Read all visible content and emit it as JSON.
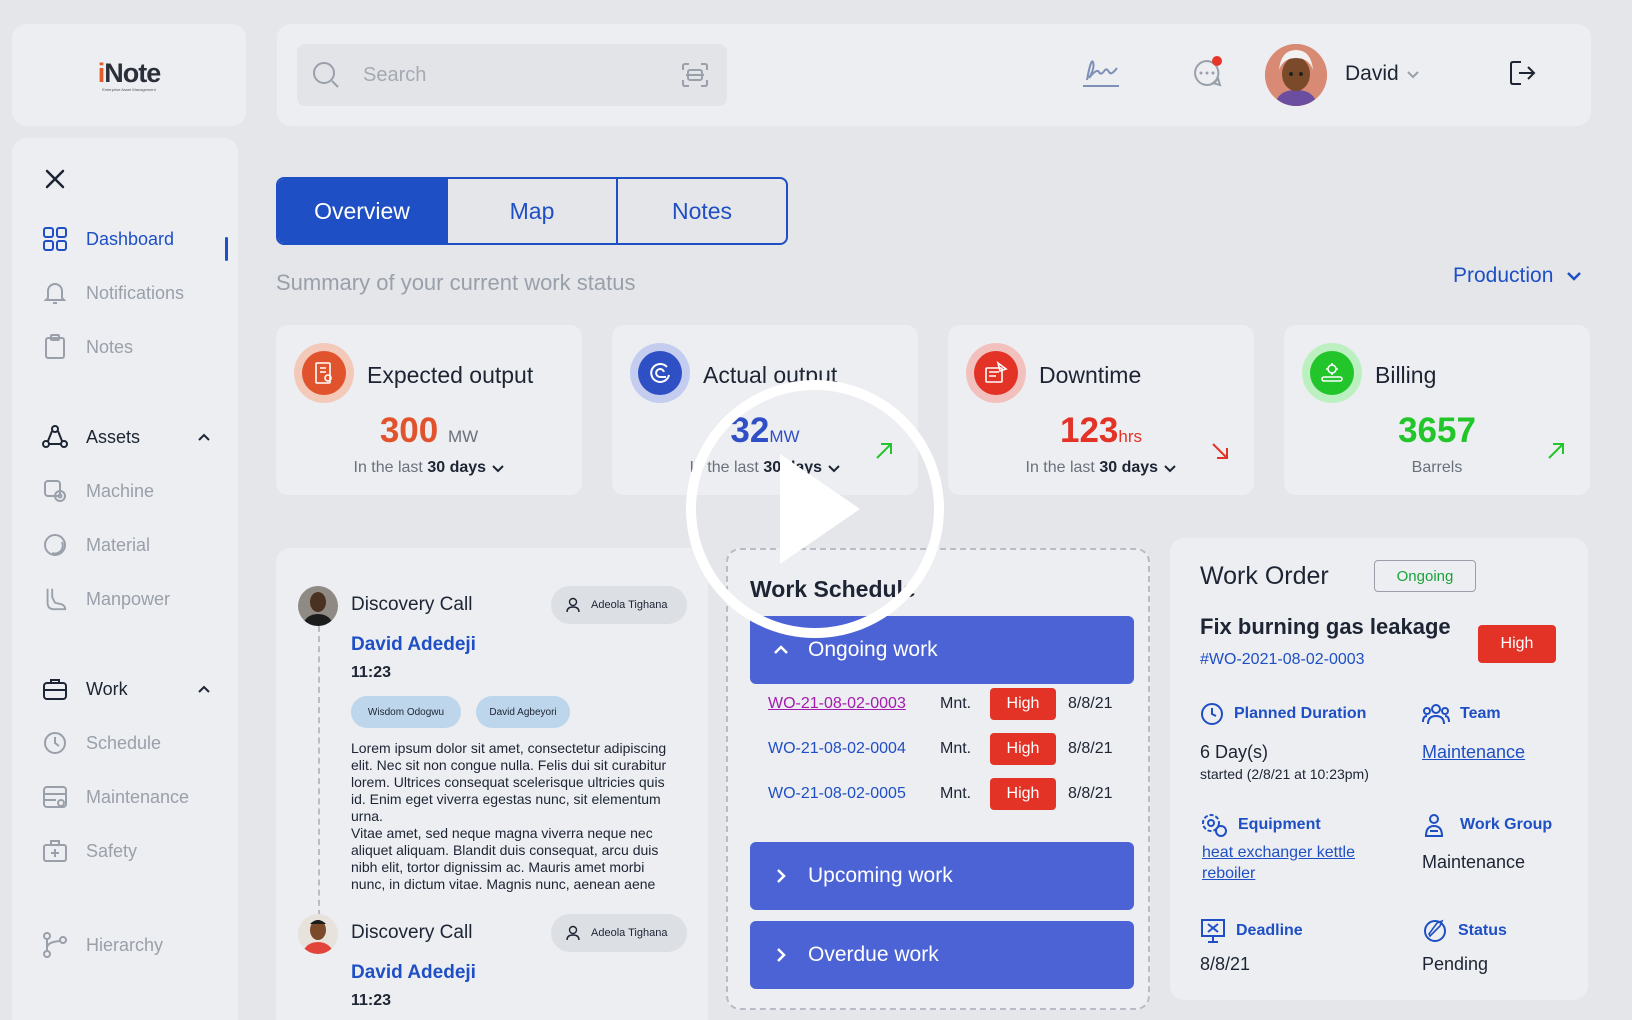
{
  "logo": {
    "text_i": "i",
    "text_rest": "Note",
    "subtitle": "Enterprise Asset Management"
  },
  "sidebar": {
    "items": [
      {
        "label": "Dashboard"
      },
      {
        "label": "Notifications"
      },
      {
        "label": "Notes"
      },
      {
        "label": "Assets"
      },
      {
        "label": "Machine"
      },
      {
        "label": "Material"
      },
      {
        "label": "Manpower"
      },
      {
        "label": "Work"
      },
      {
        "label": "Schedule"
      },
      {
        "label": "Maintenance"
      },
      {
        "label": "Safety"
      },
      {
        "label": "Hierarchy"
      }
    ]
  },
  "header": {
    "search_placeholder": "Search",
    "user_name": "David"
  },
  "tabs": [
    {
      "label": "Overview"
    },
    {
      "label": "Map"
    },
    {
      "label": "Notes"
    }
  ],
  "summary": "Summary of your current work status",
  "filter": {
    "selected": "Production"
  },
  "stats": [
    {
      "title": "Expected output",
      "value": "300",
      "unit": "MW",
      "sub_prefix": "In the last",
      "sub_period": "30 days",
      "color": "#e0532c"
    },
    {
      "title": "Actual output",
      "value": "32",
      "unit": "MW",
      "sub_prefix": "In the last",
      "sub_period": "30 days",
      "color": "#2f4fc4"
    },
    {
      "title": "Downtime",
      "value": "123",
      "unit": "hrs",
      "sub_prefix": "In the last",
      "sub_period": "30 days",
      "color": "#e33226"
    },
    {
      "title": "Billing",
      "value": "3657",
      "unit": "",
      "sub_prefix": "Barrels",
      "sub_period": "",
      "color": "#22c52a"
    }
  ],
  "timeline": {
    "entries": [
      {
        "title": "Discovery Call",
        "assignee": "Adeola Tighana",
        "person": "David Adedeji",
        "time": "11:23",
        "tags": [
          "Wisdom Odogwu",
          "David Agbeyori"
        ],
        "body1": "Lorem ipsum dolor sit amet, consectetur adipiscing elit. Nec sit non congue nulla. Felis dui sit curabitur lorem. Ultrices consequat scelerisque ultricies quis id. Enim eget viverra egestas nunc, sit elementum urna.",
        "body2": "Vitae amet, sed neque magna viverra neque nec aliquet aliquam. Blandit duis consequat, arcu duis nibh elit, tortor dignissim ac. Mauris amet morbi nunc, in dictum vitae. Magnis nunc, aenean aene"
      },
      {
        "title": "Discovery Call",
        "assignee": "Adeola Tighana",
        "person": "David Adedeji",
        "time": "11:23"
      }
    ]
  },
  "schedule": {
    "title": "Work Schedule",
    "ongoing_label": "Ongoing work",
    "upcoming_label": "Upcoming work",
    "overdue_label": "Overdue work",
    "rows": [
      {
        "id": "WO-21-08-02-0003",
        "type": "Mnt.",
        "priority": "High",
        "date": "8/8/21"
      },
      {
        "id": "WO-21-08-02-0004",
        "type": "Mnt.",
        "priority": "High",
        "date": "8/8/21"
      },
      {
        "id": "WO-21-08-02-0005",
        "type": "Mnt.",
        "priority": "High",
        "date": "8/8/21"
      }
    ]
  },
  "work_order": {
    "heading": "Work Order",
    "status_badge": "Ongoing",
    "task": "Fix burning gas leakage",
    "number": "#WO-2021-08-02-0003",
    "priority": "High",
    "planned_label": "Planned Duration",
    "planned_value": "6 Day(s)",
    "planned_started": "started (2/8/21  at 10:23pm)",
    "team_label": "Team",
    "team_value": "Maintenance",
    "equipment_label": "Equipment",
    "equipment_value_1": "heat exchanger kettle",
    "equipment_value_2": "reboiler",
    "workgroup_label": "Work Group",
    "workgroup_value": "Maintenance",
    "deadline_label": "Deadline",
    "deadline_value": "8/8/21",
    "status_label": "Status",
    "status_value": "Pending"
  }
}
